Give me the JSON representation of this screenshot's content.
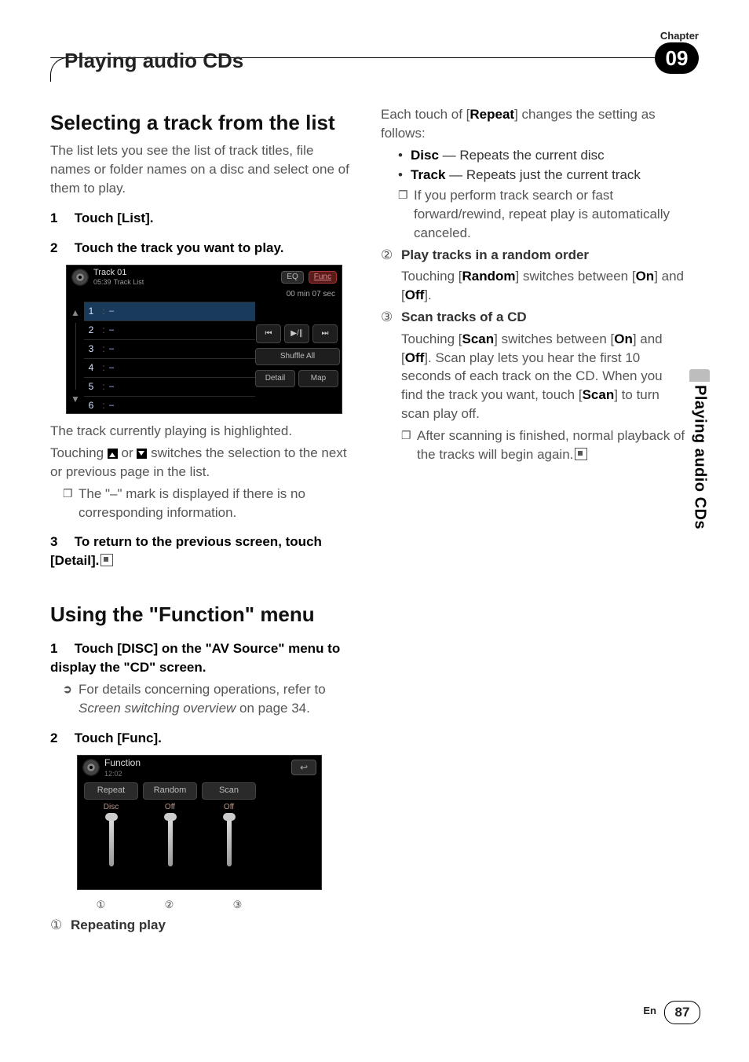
{
  "header": {
    "chapter_label": "Chapter",
    "section_title": "Playing audio CDs",
    "chapter_number": "09"
  },
  "sidetab": "Playing audio CDs",
  "footer": {
    "lang": "En",
    "page": "87"
  },
  "left": {
    "h2_select": "Selecting a track from the list",
    "lead": "The list lets you see the list of track titles, file names or folder names on a disc and select one of them to play.",
    "step1_num": "1",
    "step1_text": "Touch [List].",
    "step2_num": "2",
    "step2_text": "Touch the track you want to play.",
    "after_fig_p1": "The track currently playing is highlighted.",
    "after_fig_p2a": "Touching ",
    "after_fig_p2b": " or ",
    "after_fig_p2c": " switches the selection to the next or previous page in the list.",
    "note1": "The \"–\" mark is displayed if there is no corresponding information.",
    "step3_num": "3",
    "step3_text_a": "To return to the previous screen, touch [Detail].",
    "h2_func_a": "Using the \"",
    "h2_func_b": "Function",
    "h2_func_c": "\" menu",
    "fstep1_num": "1",
    "fstep1_text": "Touch [DISC] on the \"AV Source\" menu to display the \"CD\" screen.",
    "fstep1_sub_a": "For details concerning operations, refer to ",
    "fstep1_sub_i": "Screen switching overview",
    "fstep1_sub_b": " on page 34.",
    "fstep2_num": "2",
    "fstep2_text": "Touch [Func].",
    "enum1_num": "①",
    "enum1_title": "Repeating play"
  },
  "right": {
    "intro_a": "Each touch of [",
    "intro_b": "Repeat",
    "intro_c": "] changes the setting as follows:",
    "b1_a": "Disc",
    "b1_b": " — Repeats the current disc",
    "b2_a": "Track",
    "b2_b": " — Repeats just the current track",
    "note_repeat": "If you perform track search or fast forward/rewind, repeat play is automatically canceled.",
    "enum2_num": "②",
    "enum2_title": "Play tracks in a random order",
    "enum2_body_a": "Touching [",
    "enum2_body_b": "Random",
    "enum2_body_c": "] switches between [",
    "enum2_on": "On",
    "enum2_body_d": "] and [",
    "enum2_off": "Off",
    "enum2_body_e": "].",
    "enum3_num": "③",
    "enum3_title": "Scan tracks of a CD",
    "enum3_body_a": "Touching [",
    "enum3_body_b": "Scan",
    "enum3_body_c": "] switches between [",
    "enum3_on": "On",
    "enum3_body_d": "] and [",
    "enum3_off": "Off",
    "enum3_body_e": "]. Scan play lets you hear the first 10 seconds of each track on the CD. When you find the track you want, touch [",
    "enum3_scan2": "Scan",
    "enum3_body_f": "] to turn scan play off.",
    "note_scan": "After scanning is finished, normal playback of the tracks will begin again."
  },
  "tracklist_fig": {
    "track_label": "Track 01",
    "sub_label": "Track List",
    "eq": "EQ",
    "func": "Func",
    "clock": "05:39",
    "time": "00 min 07 sec",
    "rows": [
      {
        "n": "1",
        "c": ":",
        "t": "–"
      },
      {
        "n": "2",
        "c": ":",
        "t": "–"
      },
      {
        "n": "3",
        "c": ":",
        "t": "–"
      },
      {
        "n": "4",
        "c": ":",
        "t": "–"
      },
      {
        "n": "5",
        "c": ":",
        "t": "–"
      },
      {
        "n": "6",
        "c": ":",
        "t": "–"
      }
    ],
    "prev": "⏮",
    "play": "▶/∥",
    "next": "⏭",
    "shuffle": "Shuffle All",
    "detail": "Detail",
    "map": "Map",
    "up": "▲",
    "down": "▼"
  },
  "func_fig": {
    "title": "Function",
    "clock": "12:02",
    "back": "↩",
    "cells": [
      {
        "label": "Repeat",
        "value": "Disc"
      },
      {
        "label": "Random",
        "value": "Off"
      },
      {
        "label": "Scan",
        "value": "Off"
      }
    ],
    "nums": [
      "①",
      "②",
      "③"
    ]
  }
}
